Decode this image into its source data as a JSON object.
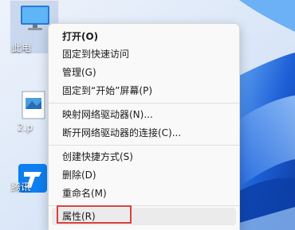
{
  "desktop": {
    "icons": [
      {
        "label": "此电",
        "icon": "this-pc-icon"
      },
      {
        "label": "2.p",
        "icon": "document-icon"
      },
      {
        "label": "腾讯",
        "icon": "tencent-app-icon"
      }
    ]
  },
  "context_menu": {
    "items": [
      {
        "label": "打开(O)"
      },
      {
        "label": "固定到快速访问"
      },
      {
        "label": "管理(G)"
      },
      {
        "label": "固定到“开始”屏幕(P)"
      },
      {
        "label": "映射网络驱动器(N)..."
      },
      {
        "label": "断开网络驱动器的连接(C)..."
      },
      {
        "label": "创建快捷方式(S)"
      },
      {
        "label": "删除(D)"
      },
      {
        "label": "重命名(M)"
      },
      {
        "label": "属性(R)"
      }
    ]
  },
  "colors": {
    "highlight_border": "#d94040",
    "menu_background": "#f9f9f9",
    "wallpaper_accent": "#1d5fd6"
  }
}
